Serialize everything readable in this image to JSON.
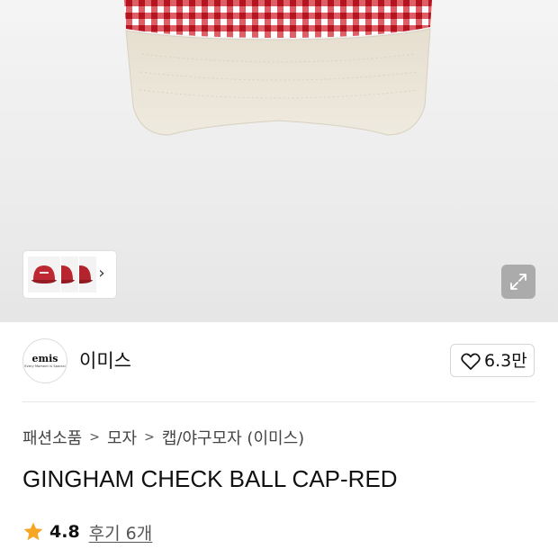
{
  "product_image": {
    "icons": {
      "expand": "expand-arrows-icon",
      "next": "chevron-right-icon"
    }
  },
  "brand": {
    "logo_text": "emis",
    "logo_subtext": "Every Moment is Special",
    "name": "이미스",
    "likes": "6.3만"
  },
  "breadcrumb": [
    "패션소품",
    "모자",
    "캡/야구모자 (이미스)"
  ],
  "product": {
    "title": "GINGHAM CHECK BALL CAP-RED",
    "rating": "4.8",
    "reviews": "후기 6개"
  },
  "colors": {
    "accent_star": "#f5a623",
    "gingham_red": "#c8202a",
    "visor": "#ebe5d8"
  }
}
